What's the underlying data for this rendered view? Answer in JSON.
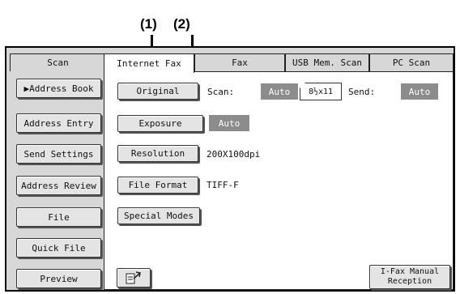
{
  "callouts": [
    "(1)",
    "(2)"
  ],
  "tabs": [
    "Scan",
    "Internet Fax",
    "Fax",
    "USB Mem. Scan",
    "PC Scan"
  ],
  "sidebar": [
    "▶Address Book",
    "Address Entry",
    "Send Settings",
    "Address Review",
    "File",
    "Quick File",
    "Preview"
  ],
  "original": {
    "button": "Original",
    "scan_label": "Scan:",
    "scan_value": "Auto",
    "paper_size": "8½x11",
    "send_label": "Send:",
    "send_value": "Auto"
  },
  "exposure": {
    "button": "Exposure",
    "value": "Auto"
  },
  "resolution": {
    "button": "Resolution",
    "value": "200X100dpi"
  },
  "file_format": {
    "button": "File Format",
    "value": "TIFF-F"
  },
  "special_modes": {
    "button": "Special Modes"
  },
  "manual_reception": {
    "line1": "I-Fax Manual",
    "line2": "Reception"
  },
  "icons": {
    "send_status": "document-arrow-icon"
  },
  "colors": {
    "panel": "#d7d7d7",
    "chip": "#8c8c8c"
  }
}
